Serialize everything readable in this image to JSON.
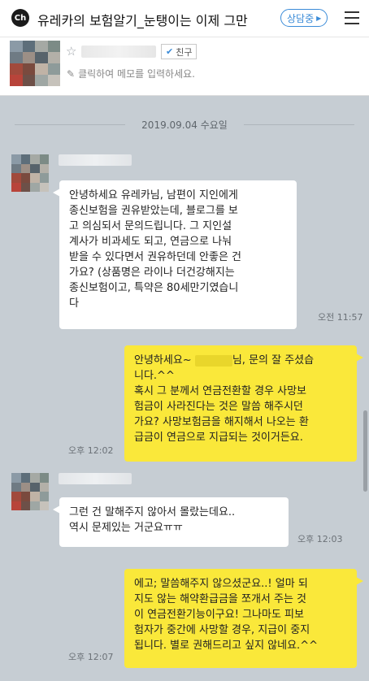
{
  "header": {
    "logo_text": "Ch",
    "title": "유레카의 보험알기_눈탱이는 이제 그만",
    "consult_badge": "상담중",
    "consult_arrow": "▶"
  },
  "profile": {
    "friend_label": "친구",
    "memo_placeholder": "클릭하여 메모를 입력하세요."
  },
  "chat": {
    "date": "2019.09.04 수요일",
    "messages": [
      {
        "from": "other",
        "text": "안녕하세요 유레카님, 남편이 지인에게\n종신보험을 권유받았는데, 블로그를 보\n고 의심되서 문의드립니다. 그 지인설\n계사가 비과세도 되고, 연금으로 나눠\n받을 수 있다면서 권유하던데 안좋은 건\n가요? (상품명은 라이나 더건강해지는\n종신보험이고, 특약은 80세만기였습니\n다",
        "time": "오전 11:57"
      },
      {
        "from": "me",
        "greeting": "안녕하세요~",
        "greeting_rest": "님, 문의 잘 주셨습\n니다.^^\n혹시 그 분께서 연금전환할 경우 사망보\n험금이 사라진다는 것은 말씀 해주시던\n가요? 사망보험금을 해지해서 나오는 환\n급금이 연금으로 지급되는 것이거든요.",
        "time": "오후 12:02"
      },
      {
        "from": "other",
        "text": "그런 건 말해주지 않아서 몰랐는데요..\n역시 문제있는 거군요ㅠㅠ",
        "time": "오후 12:03"
      },
      {
        "from": "me",
        "text": "에고; 말씀해주지 않으셨군요..! 얼마 되\n지도 않는 해약환급금을 쪼개서 주는 것\n이 연금전환기능이구요! 그나마도 피보\n험자가 중간에 사망할 경우, 지급이 중지\n됩니다. 별로 권해드리고 싶지 않네요.^^",
        "time": "오후 12:07"
      }
    ]
  },
  "colors": {
    "chat_bg": "#c6cdd3",
    "my_bubble": "#fae83a",
    "other_bubble": "#ffffff",
    "accent": "#3a8bd8"
  },
  "icons": [
    "channel-logo-icon",
    "chevron-right-icon",
    "hamburger-menu-icon",
    "star-icon",
    "check-icon",
    "pencil-icon"
  ]
}
